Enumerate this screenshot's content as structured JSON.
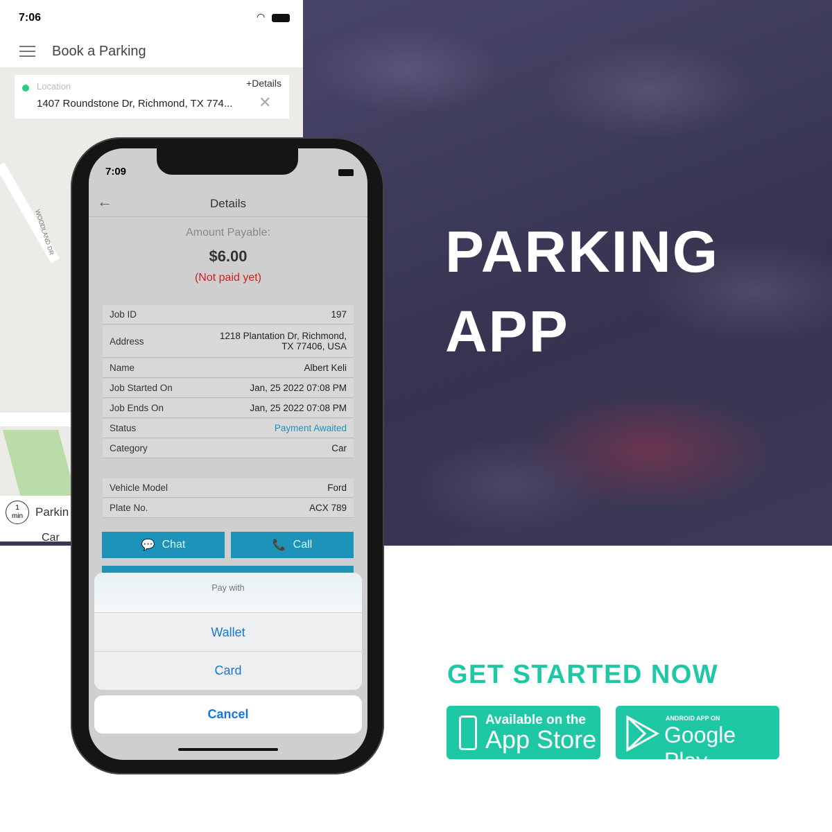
{
  "hero": {
    "line1": "PARKING",
    "line2": "APP",
    "cta": "GET STARTED NOW"
  },
  "badges": {
    "appstore_small": "Available on the",
    "appstore_big": "App Store",
    "play_small": "ANDROID APP ON",
    "play_big": "Google Play"
  },
  "colors": {
    "accent": "#1ec8a5",
    "button": "#1d93b9",
    "link": "#1677d6",
    "unpaid": "#cc1f1f"
  },
  "back_screen": {
    "time": "7:06",
    "title": "Book a Parking",
    "location_label": "Location",
    "details_link": "+Details",
    "address": "1407 Roundstone Dr, Richmond, TX 774...",
    "street": "WOODLAND DR",
    "eta_num": "1",
    "eta_unit": "min",
    "list_title": "Parkin",
    "list_sub": "Car"
  },
  "front_screen": {
    "time": "7:09",
    "title": "Details",
    "amount_label": "Amount Payable:",
    "amount": "$6.00",
    "pay_status": "(Not paid yet)",
    "rows": [
      {
        "label": "Job ID",
        "value": "197"
      },
      {
        "label": "Address",
        "value": "1218 Plantation Dr, Richmond,",
        "value2": "TX 77406, USA"
      },
      {
        "label": "Name",
        "value": "Albert Keli"
      },
      {
        "label": "Job  Started On",
        "value": "Jan, 25 2022 07:08 PM"
      },
      {
        "label": "Job Ends On",
        "value": "Jan, 25 2022 07:08 PM"
      },
      {
        "label": "Status",
        "value": "Payment Awaited"
      },
      {
        "label": "Category",
        "value": "Car"
      },
      {
        "label": "Vehicle Model",
        "value": "Ford"
      },
      {
        "label": "Plate No.",
        "value": "ACX 789"
      }
    ],
    "chat": "Chat",
    "call": "Call",
    "sheet": {
      "title": "Pay with",
      "options": [
        "Wallet",
        "Card"
      ],
      "cancel": "Cancel"
    }
  }
}
